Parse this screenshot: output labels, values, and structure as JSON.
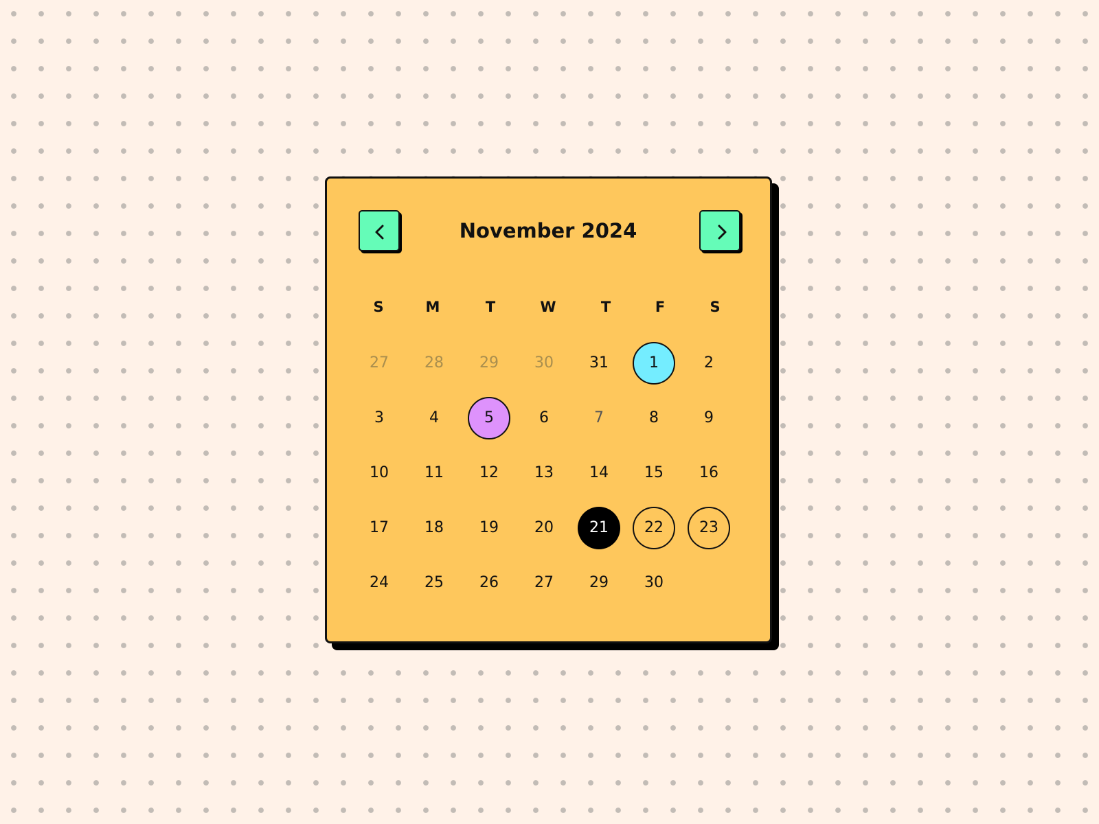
{
  "calendar": {
    "month_label": "November 2024",
    "prev_icon": "chevron-left-icon",
    "next_icon": "chevron-right-icon",
    "weekdays": [
      "S",
      "M",
      "T",
      "W",
      "T",
      "F",
      "S"
    ],
    "weeks": [
      [
        "27",
        "28",
        "29",
        "30",
        "31",
        "1",
        "2"
      ],
      [
        "3",
        "4",
        "5",
        "6",
        "7",
        "8",
        "9"
      ],
      [
        "10",
        "11",
        "12",
        "13",
        "14",
        "15",
        "16"
      ],
      [
        "17",
        "18",
        "19",
        "20",
        "21",
        "22",
        "23"
      ],
      [
        "24",
        "25",
        "26",
        "27",
        "29",
        "30"
      ]
    ]
  },
  "colors": {
    "page_background": "#fff2e8",
    "dot": "#c2bcb6",
    "card": "#fec75c",
    "nav_button": "#65fcb8",
    "event_cyan": "#74edff",
    "event_violet": "#de92fc",
    "selected": "#000000",
    "muted_text": "#a98e4e"
  }
}
